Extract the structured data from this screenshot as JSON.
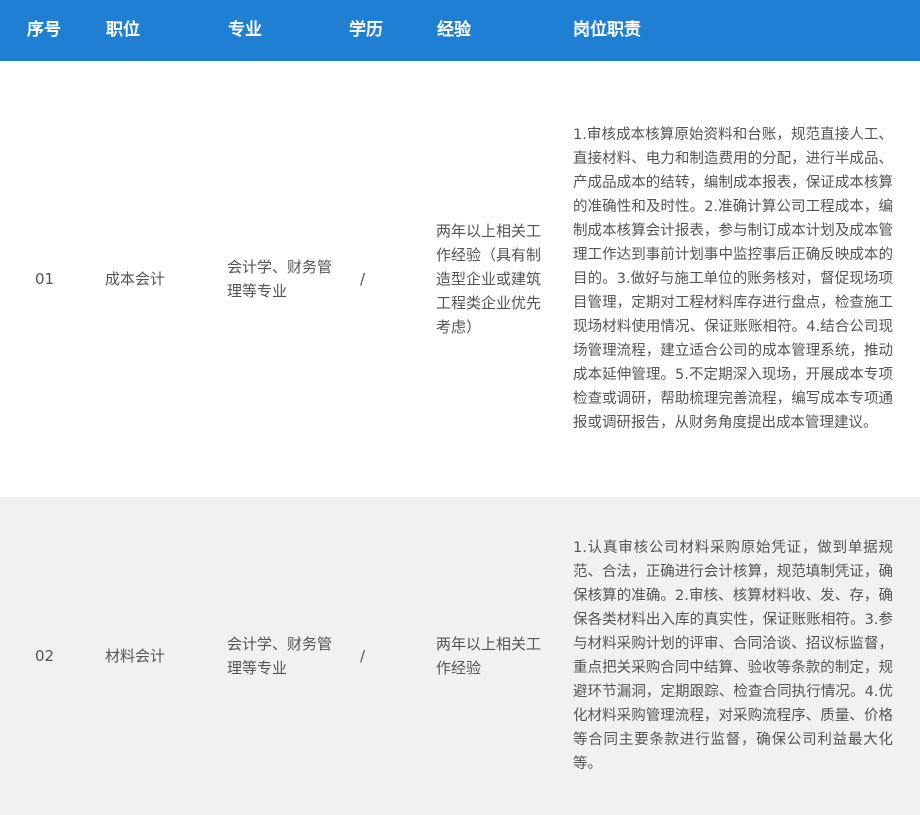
{
  "header": {
    "no": "序号",
    "title": "职位",
    "major": "专业",
    "education": "学历",
    "experience": "经验",
    "duties": "岗位职责"
  },
  "colors": {
    "header_bg": "#1f7fd2",
    "row_alt_bg": "#f1f1f1",
    "text": "#555555"
  },
  "rows": [
    {
      "no": "01",
      "title": "成本会计",
      "major": "会计学、财务管理等专业",
      "education": "/",
      "experience": "两年以上相关工作经验（具有制造型企业或建筑工程类企业优先考虑）",
      "duties": "1.审核成本核算原始资料和台账，规范直接人工、直接材料、电力和制造费用的分配，进行半成品、产成品成本的结转，编制成本报表，保证成本核算的准确性和及时性。2.准确计算公司工程成本，编制成本核算会计报表，参与制订成本计划及成本管理工作达到事前计划事中监控事后正确反映成本的目的。3.做好与施工单位的账务核对，督促现场项目管理，定期对工程材料库存进行盘点，检查施工现场材料使用情况、保证账账相符。4.结合公司现场管理流程，建立适合公司的成本管理系统，推动成本延伸管理。5.不定期深入现场，开展成本专项检查或调研，帮助梳理完善流程，编写成本专项通报或调研报告，从财务角度提出成本管理建议。"
    },
    {
      "no": "02",
      "title": "材料会计",
      "major": "会计学、财务管理等专业",
      "education": "/",
      "experience": "两年以上相关工作经验",
      "duties": "1.认真审核公司材料采购原始凭证，做到单据规范、合法，正确进行会计核算，规范填制凭证，确保核算的准确。2.审核、核算材料收、发、存，确保各类材料出入库的真实性，保证账账相符。3.参与材料采购计划的评审、合同洽谈、招议标监督，重点把关采购合同中结算、验收等条款的制定，规避环节漏洞，定期跟踪、检查合同执行情况。4.优化材料采购管理流程，对采购流程序、质量、价格等合同主要条款进行监督，确保公司利益最大化等。"
    }
  ]
}
